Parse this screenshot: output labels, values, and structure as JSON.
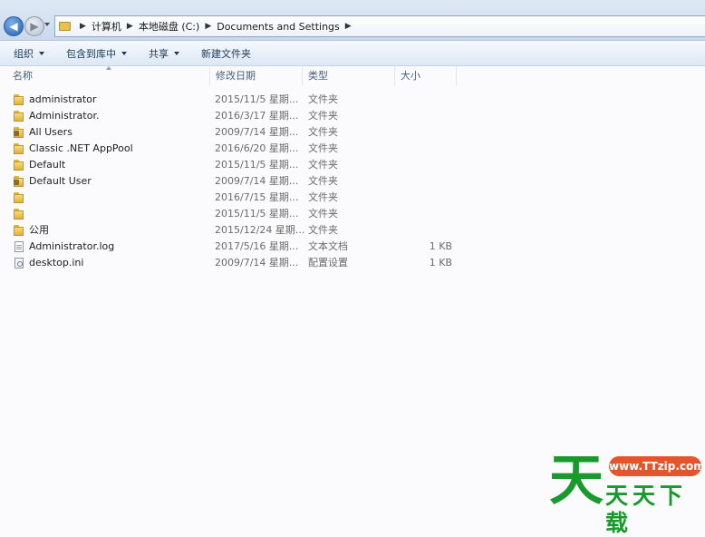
{
  "address_bar": {
    "crumbs": [
      "计算机",
      "本地磁盘 (C:)",
      "Documents and Settings"
    ]
  },
  "toolbar": {
    "organize_label": "组织",
    "include_in_library_label": "包含到库中",
    "share_label": "共享",
    "new_folder_label": "新建文件夹"
  },
  "columns": {
    "name": "名称",
    "modified": "修改日期",
    "type": "类型",
    "size": "大小"
  },
  "rows": [
    {
      "name": "administrator",
      "date": "2015/11/5 星期...",
      "type": "文件夹",
      "size": "",
      "icon": "folder-icon"
    },
    {
      "name": "Administrator.",
      "date": "2016/3/17 星期...",
      "type": "文件夹",
      "size": "",
      "icon": "folder-icon"
    },
    {
      "name": "All Users",
      "date": "2009/7/14 星期...",
      "type": "文件夹",
      "size": "",
      "icon": "locked-folder-icon"
    },
    {
      "name": "Classic .NET AppPool",
      "date": "2016/6/20 星期...",
      "type": "文件夹",
      "size": "",
      "icon": "folder-icon"
    },
    {
      "name": "Default",
      "date": "2015/11/5 星期...",
      "type": "文件夹",
      "size": "",
      "icon": "folder-icon"
    },
    {
      "name": "Default User",
      "date": "2009/7/14 星期...",
      "type": "文件夹",
      "size": "",
      "icon": "locked-folder-icon"
    },
    {
      "name": "",
      "date": "2016/7/15 星期...",
      "type": "文件夹",
      "size": "",
      "icon": "folder-icon"
    },
    {
      "name": "",
      "date": "2015/11/5 星期...",
      "type": "文件夹",
      "size": "",
      "icon": "folder-icon"
    },
    {
      "name": "公用",
      "date": "2015/12/24 星期...",
      "type": "文件夹",
      "size": "",
      "icon": "folder-icon"
    },
    {
      "name": "Administrator.log",
      "date": "2017/5/16 星期...",
      "type": "文本文档",
      "size": "1 KB",
      "icon": "text-file-icon"
    },
    {
      "name": "desktop.ini",
      "date": "2009/7/14 星期...",
      "type": "配置设置",
      "size": "1 KB",
      "icon": "settings-file-icon"
    }
  ],
  "watermark": {
    "big_char": "天",
    "site": "www.TTzip.com",
    "subtitle": "天天下载"
  },
  "colors": {
    "watermark_green": "#1a9a2e",
    "watermark_orange": "#e5552c",
    "toolbar_text": "#1e395b"
  }
}
